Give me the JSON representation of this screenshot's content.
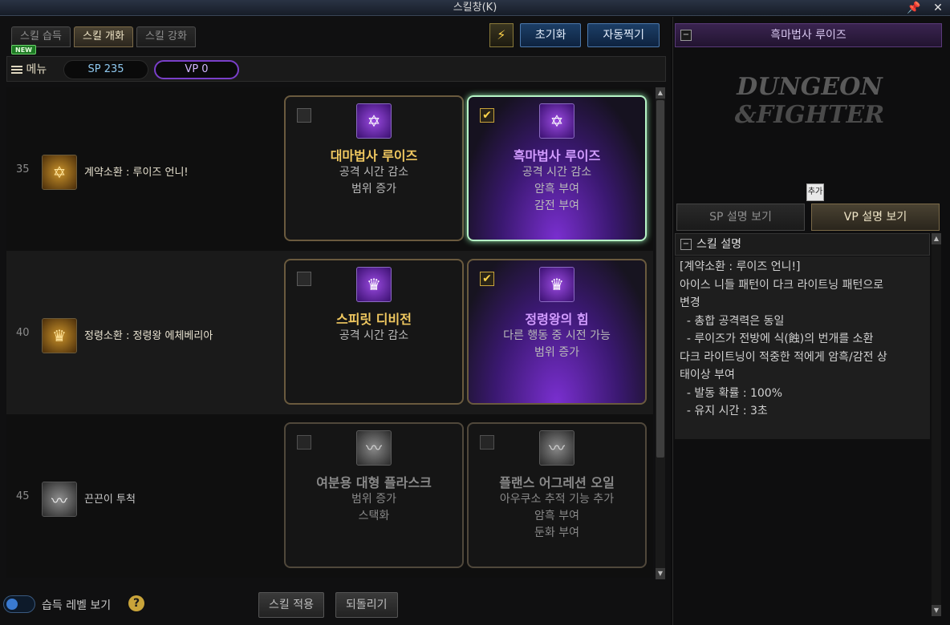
{
  "window": {
    "title": "스킬창(K)"
  },
  "tabs": [
    {
      "label": "스킬 습득",
      "active": false
    },
    {
      "label": "스킬 개화",
      "active": true
    },
    {
      "label": "스킬 강화",
      "active": false
    }
  ],
  "new_badge": "NEW",
  "toolbar": {
    "reset_label": "초기화",
    "auto_label": "자동찍기"
  },
  "menubar": {
    "menu_label": "메뉴",
    "sp": "SP 235",
    "vp": "VP 0"
  },
  "rows": [
    {
      "level": "35",
      "skill_name": "계약소환 : 루이즈 언니!",
      "icon": "contract-sigil-icon",
      "cards": [
        {
          "checked": false,
          "title": "대마법사 루이즈",
          "lines": [
            "공격 시간 감소",
            "범위 증가"
          ]
        },
        {
          "checked": true,
          "title": "흑마법사 루이즈",
          "lines": [
            "공격 시간 감소",
            "암흑 부여",
            "감전 부여"
          ]
        }
      ]
    },
    {
      "level": "40",
      "skill_name": "정령소환 : 정령왕 에체베리아",
      "icon": "crown-icon",
      "cards": [
        {
          "checked": false,
          "title": "스피릿 디비전",
          "lines": [
            "공격 시간 감소"
          ]
        },
        {
          "checked": true,
          "title": "정령왕의 힘",
          "lines": [
            "다른 행동 중 시전 가능",
            "범위 증가"
          ]
        }
      ]
    },
    {
      "level": "45",
      "skill_name": "끈끈이 투척",
      "icon": "slime-icon",
      "cards": [
        {
          "checked": false,
          "title": "여분용 대형 플라스크",
          "lines": [
            "범위 증가",
            "스택화"
          ]
        },
        {
          "checked": false,
          "title": "플랜스 어그레션 오일",
          "lines": [
            "아우쿠소 추적 기능 추가",
            "암흑 부여",
            "둔화 부여"
          ]
        }
      ]
    }
  ],
  "bottom": {
    "toggle_label": "습득 레벨 보기",
    "help": "?",
    "apply_label": "스킬 적용",
    "revert_label": "되돌리기"
  },
  "right": {
    "header": "흑마법사 루이즈",
    "logo_line1": "DUNGEON",
    "logo_line2": "&FIGHTER",
    "add_tip": "추가",
    "tab_sp": "SP 설명 보기",
    "tab_vp": "VP 설명 보기",
    "desc_title": "스킬 설명",
    "desc_lines": [
      "[계약소환 : 루이즈 언니!]",
      "아이스 니들 패턴이 다크 라이트닝 패턴으로",
      "변경",
      "  - 총합 공격력은 동일",
      "  - 루이즈가 전방에 식(蝕)의 번개를 소환",
      "",
      "다크 라이트닝이 적중한 적에게 암흑/감전 상",
      "태이상 부여",
      "  - 발동 확률 : 100%",
      "  - 유지 시간 : 3초"
    ]
  }
}
